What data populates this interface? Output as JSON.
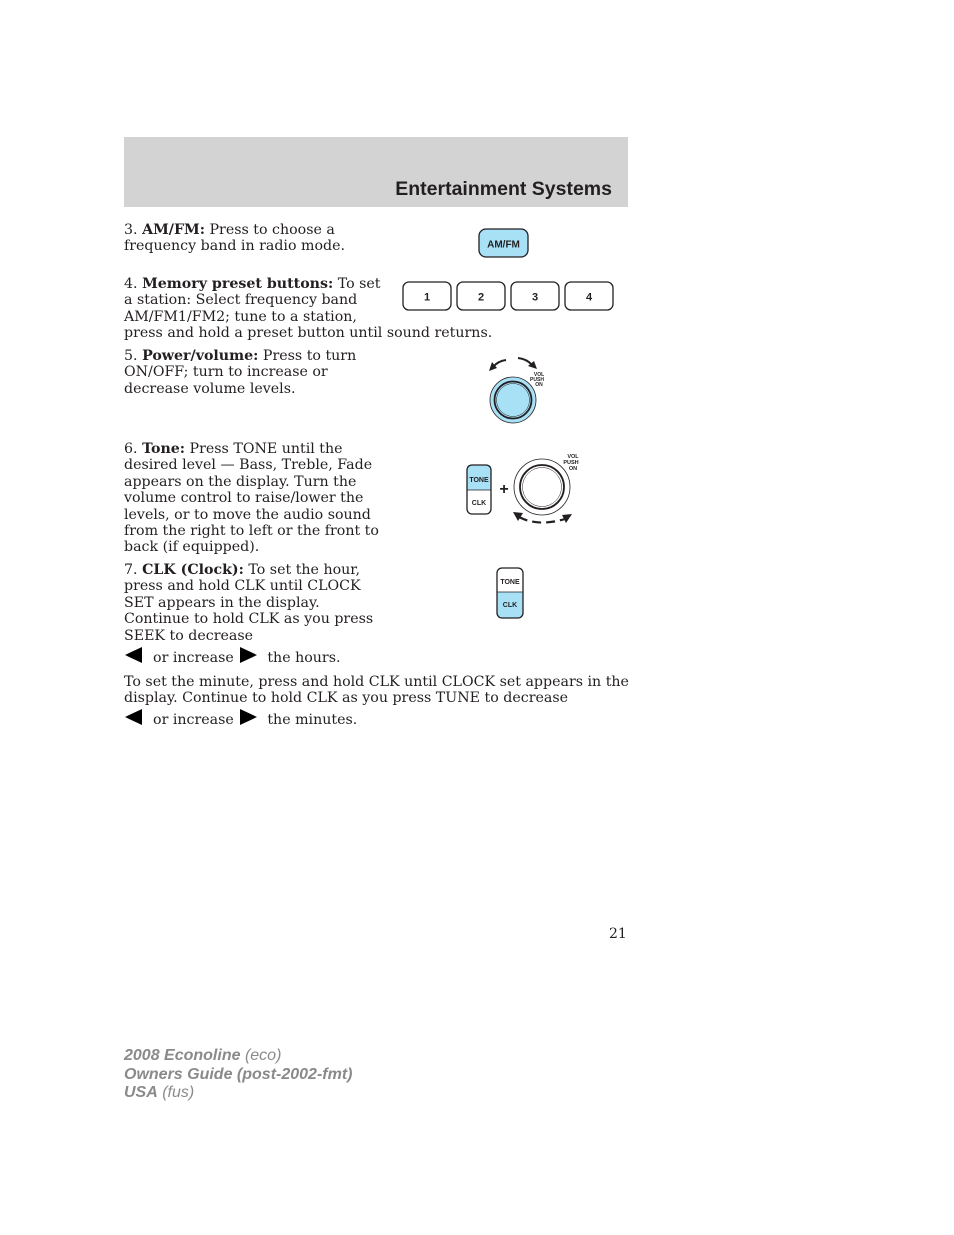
{
  "header": {
    "title": "Entertainment Systems"
  },
  "items": [
    {
      "num": "3.",
      "label": "AM/FM:",
      "lines": [
        " Press to choose a",
        "frequency band in radio mode."
      ]
    },
    {
      "num": "4.",
      "label": "Memory preset buttons:",
      "lines": [
        " To set",
        "a station: Select frequency band",
        "AM/FM1/FM2; tune to a station,",
        "press and hold a preset button until sound returns."
      ]
    },
    {
      "num": "5.",
      "label": "Power/volume:",
      "lines": [
        " Press to turn",
        "ON/OFF; turn to increase or",
        "decrease volume levels."
      ]
    },
    {
      "num": "6.",
      "label": "Tone:",
      "lines": [
        " Press TONE until the",
        "desired level — Bass, Treble, Fade",
        "appears on the display. Turn the",
        "volume control to raise/lower the",
        "levels, or to move the audio sound",
        "from the right to left or the front to",
        "back (if equipped)."
      ]
    },
    {
      "num": "7.",
      "label": "CLK (Clock):",
      "lines": [
        " To set the hour,",
        "press and hold CLK until CLOCK",
        "SET appears in the display.",
        "Continue to hold CLK as you press",
        "SEEK to decrease"
      ],
      "tail": {
        "mid": "or increase",
        "end": "the hours."
      }
    }
  ],
  "minutes_para": {
    "lines": [
      "To set the minute, press and hold CLK until CLOCK set appears in the",
      "display. Continue to hold CLK as you press TUNE to decrease"
    ],
    "tail": {
      "mid": "or increase",
      "end": "the minutes."
    }
  },
  "figures": {
    "amfm_button": "AM/FM",
    "preset_buttons": [
      "1",
      "2",
      "3",
      "4"
    ],
    "knob_label": [
      "VOL",
      "PUSH",
      "ON"
    ],
    "tone_label": "TONE",
    "clk_label": "CLK",
    "plus": "+",
    "colors": {
      "highlight": "#a8e0f6",
      "outline": "#231f20"
    }
  },
  "page_number": "21",
  "footer": {
    "line1_bold": "2008 Econoline",
    "line1_italic": " (eco)",
    "line2_bold": "Owners Guide (post-2002-fmt)",
    "line3_bold": "USA",
    "line3_italic": " (fus)"
  }
}
